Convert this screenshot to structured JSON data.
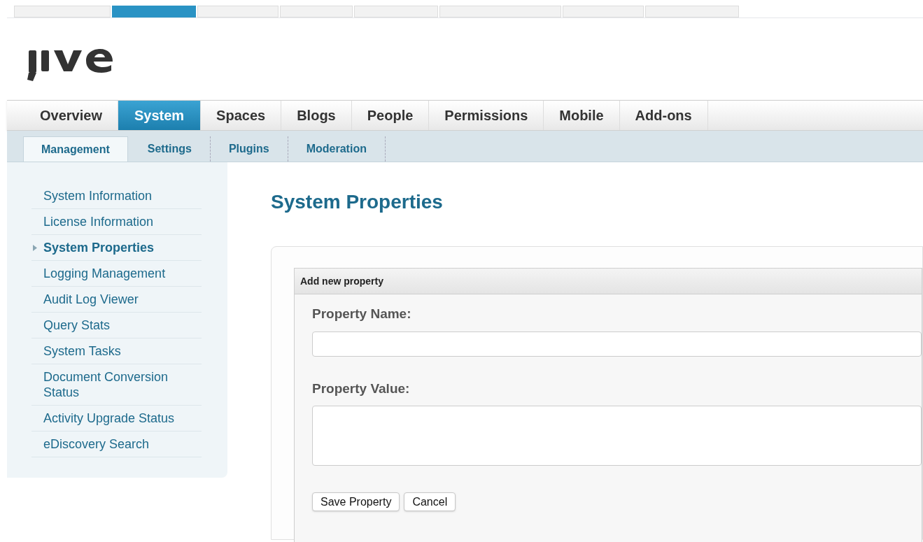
{
  "tabs": [
    {
      "label": "Overview",
      "selected": false
    },
    {
      "label": "System",
      "selected": true
    },
    {
      "label": "Spaces",
      "selected": false
    },
    {
      "label": "Blogs",
      "selected": false
    },
    {
      "label": "People",
      "selected": false
    },
    {
      "label": "Permissions",
      "selected": false
    },
    {
      "label": "Mobile",
      "selected": false
    },
    {
      "label": "Add-ons",
      "selected": false
    }
  ],
  "subtabs": [
    {
      "label": "Management",
      "selected": true
    },
    {
      "label": "Settings",
      "selected": false
    },
    {
      "label": "Plugins",
      "selected": false
    },
    {
      "label": "Moderation",
      "selected": false
    }
  ],
  "sidebar": {
    "items": [
      {
        "label": "System Information",
        "selected": false
      },
      {
        "label": "License Information",
        "selected": false
      },
      {
        "label": "System Properties",
        "selected": true
      },
      {
        "label": "Logging Management",
        "selected": false
      },
      {
        "label": "Audit Log Viewer",
        "selected": false
      },
      {
        "label": "Query Stats",
        "selected": false
      },
      {
        "label": "System Tasks",
        "selected": false
      },
      {
        "label": "Document Conversion Status",
        "selected": false
      },
      {
        "label": "Activity Upgrade Status",
        "selected": false
      },
      {
        "label": "eDiscovery Search",
        "selected": false
      }
    ]
  },
  "page_title": "System Properties",
  "form": {
    "title": "Add new property",
    "fields": [
      {
        "kind": "input",
        "label": "Property Name:"
      },
      {
        "kind": "textarea",
        "label": "Property Value:"
      }
    ],
    "buttons": [
      "Save Property",
      "Cancel"
    ]
  }
}
